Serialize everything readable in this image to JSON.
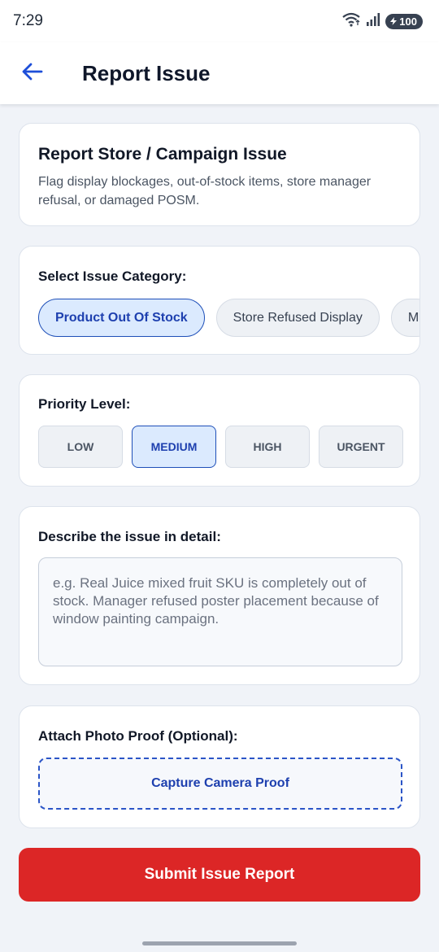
{
  "status_bar": {
    "time": "7:29",
    "battery": "100",
    "icons": [
      "wifi-icon",
      "signal-icon",
      "battery-icon"
    ]
  },
  "app_bar": {
    "title": "Report Issue",
    "back_icon": "arrow-left-icon"
  },
  "intro": {
    "title": "Report Store / Campaign Issue",
    "description": "Flag display blockages, out-of-stock items, store manager refusal, or damaged POSM."
  },
  "category": {
    "label": "Select Issue Category:",
    "options": [
      "Product Out Of Stock",
      "Store Refused Display",
      "M"
    ],
    "selected": "Product Out Of Stock"
  },
  "priority": {
    "label": "Priority Level:",
    "options": [
      "LOW",
      "MEDIUM",
      "HIGH",
      "URGENT"
    ],
    "selected": "MEDIUM"
  },
  "description": {
    "label": "Describe the issue in detail:",
    "placeholder": "e.g. Real Juice mixed fruit SKU is completely out of stock. Manager refused poster placement because of window painting campaign.",
    "value": ""
  },
  "photo": {
    "label": "Attach Photo Proof (Optional):",
    "button_label": "Capture Camera Proof"
  },
  "submit": {
    "label": "Submit Issue Report"
  },
  "colors": {
    "primary": "#1e40af",
    "accent_back": "#1d4ed8",
    "danger": "#dc2626",
    "background": "#f0f3f8"
  }
}
